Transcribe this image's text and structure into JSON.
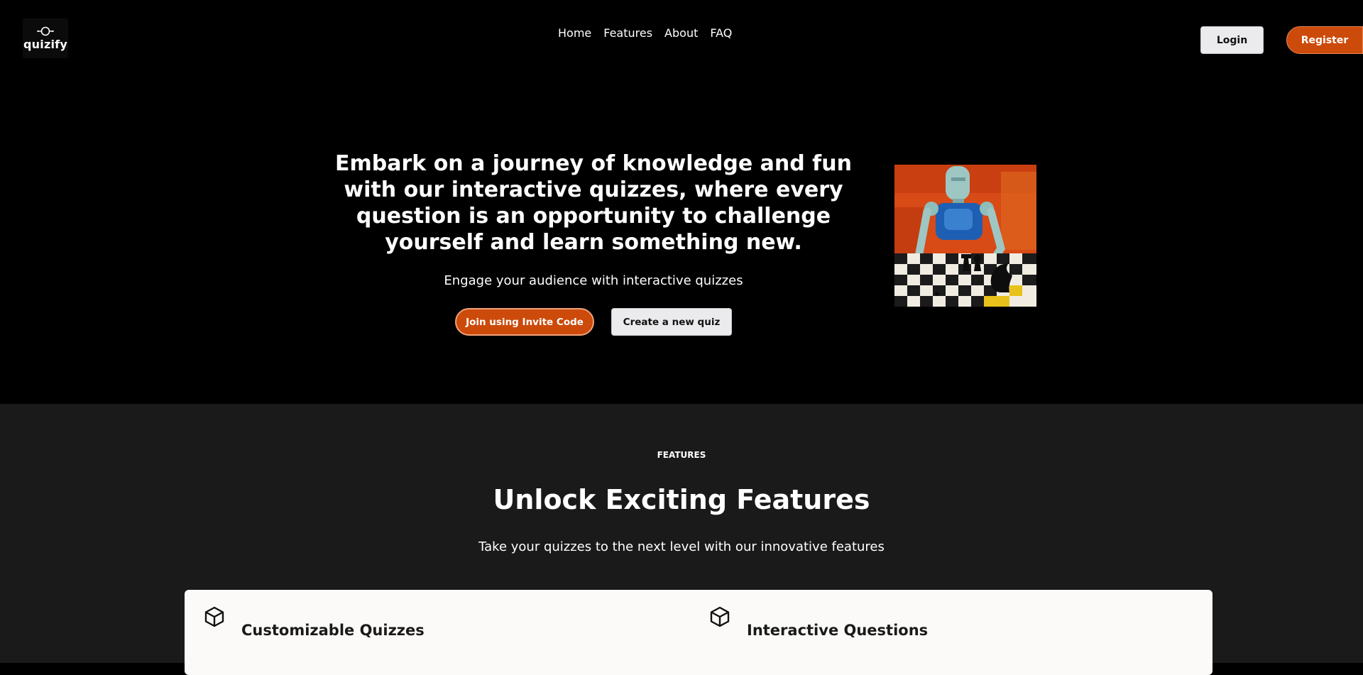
{
  "brand": {
    "name": "quizify"
  },
  "nav": {
    "items": [
      {
        "label": "Home"
      },
      {
        "label": "Features"
      },
      {
        "label": "About"
      },
      {
        "label": "FAQ"
      }
    ]
  },
  "auth": {
    "login_label": "Login",
    "register_label": "Register"
  },
  "hero": {
    "title": "Embark on a journey of knowledge and fun with our interactive quizzes, where every question is an opportunity to challenge yourself and learn something new.",
    "subtitle": "Engage your audience with interactive quizzes",
    "join_label": "Join using Invite Code",
    "create_label": "Create a new quiz"
  },
  "features": {
    "eyebrow": "FEATURES",
    "title": "Unlock Exciting Features",
    "subtitle": "Take your quizzes to the next level with our innovative features",
    "cards": [
      {
        "title": "Customizable Quizzes",
        "icon": "cube-icon"
      },
      {
        "title": "Interactive Questions",
        "icon": "cube-icon"
      }
    ]
  },
  "colors": {
    "accent": "#cc4a0a",
    "hero_bg": "#000000",
    "features_bg": "#1a1a1a",
    "panel_bg": "#fbfaf8"
  }
}
